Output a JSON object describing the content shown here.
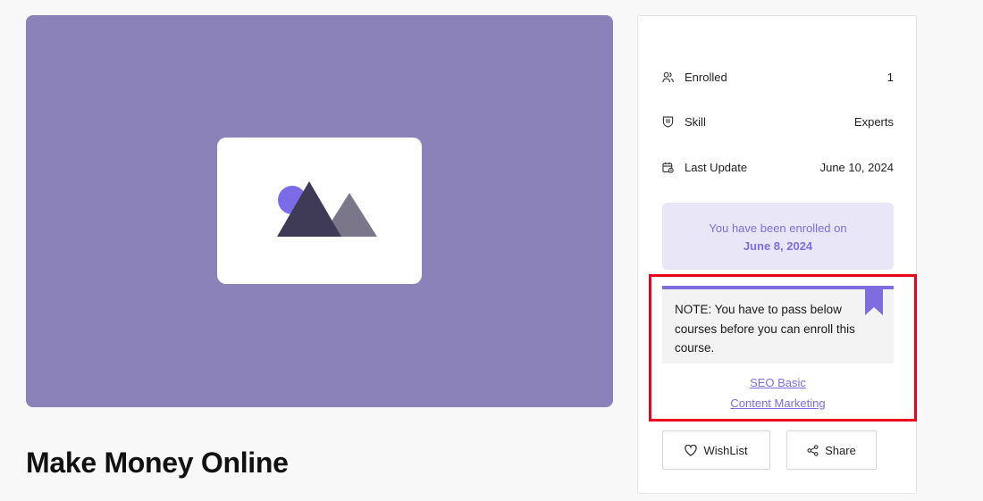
{
  "course": {
    "title": "Make Money Online",
    "thumbnail_icon": "image-placeholder-icon"
  },
  "sidebar": {
    "meta": [
      {
        "icon": "users-icon",
        "label": "Enrolled",
        "value": "1"
      },
      {
        "icon": "skill-badge-icon",
        "label": "Skill",
        "value": "Experts"
      },
      {
        "icon": "calendar-icon",
        "label": "Last Update",
        "value": "June 10, 2024"
      }
    ],
    "enrolled": {
      "text": "You have been enrolled on",
      "date": "June 8, 2024"
    },
    "note": {
      "text": "NOTE: You have to pass below courses before you can enroll this course."
    },
    "prerequisites": [
      {
        "label": "SEO Basic"
      },
      {
        "label": "Content Marketing"
      }
    ],
    "buttons": {
      "wishlist_label": "WishList",
      "share_label": "Share"
    }
  },
  "colors": {
    "accent": "#7f6de0",
    "thumbnail_bg": "#8a82b9",
    "enrolled_bg": "#e9e6f8",
    "highlight": "#e8001c"
  }
}
